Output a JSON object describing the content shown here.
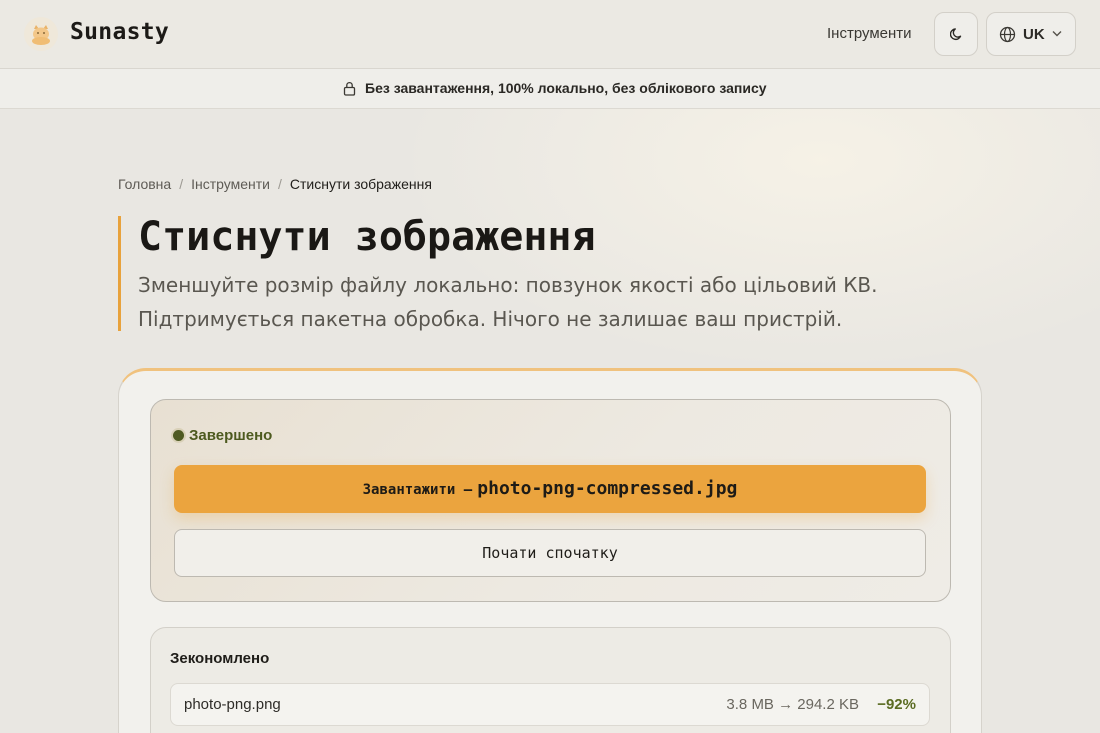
{
  "header": {
    "brand": "Sunasty",
    "nav_tools": "Інструменти",
    "theme_icon": "moon-icon",
    "language": "UK"
  },
  "privacy_bar": {
    "text": "Без завантаження, 100% локально, без облікового запису"
  },
  "breadcrumb": {
    "home": "Головна",
    "tools": "Інструменти",
    "current": "Стиснути зображення"
  },
  "page": {
    "title": "Стиснути зображення",
    "description": "Зменшуйте розмір файлу локально: повзунок якості або цільовий КВ. Підтримується пакетна обробка. Нічого не залишає ваш пристрій."
  },
  "status": {
    "label": "Завершено",
    "download_label": "Завантажити —",
    "download_file": "photo-png-compressed.jpg",
    "restart_label": "Почати спочатку"
  },
  "savings": {
    "title": "Зекономлено",
    "files": [
      {
        "name": "photo-png.png",
        "sizes": "3.8 MB → 294.2 KB",
        "percent": "−92%"
      }
    ]
  },
  "colors": {
    "accent": "#eba43e",
    "success": "#5a6b22",
    "background": "#e9e7e2"
  }
}
